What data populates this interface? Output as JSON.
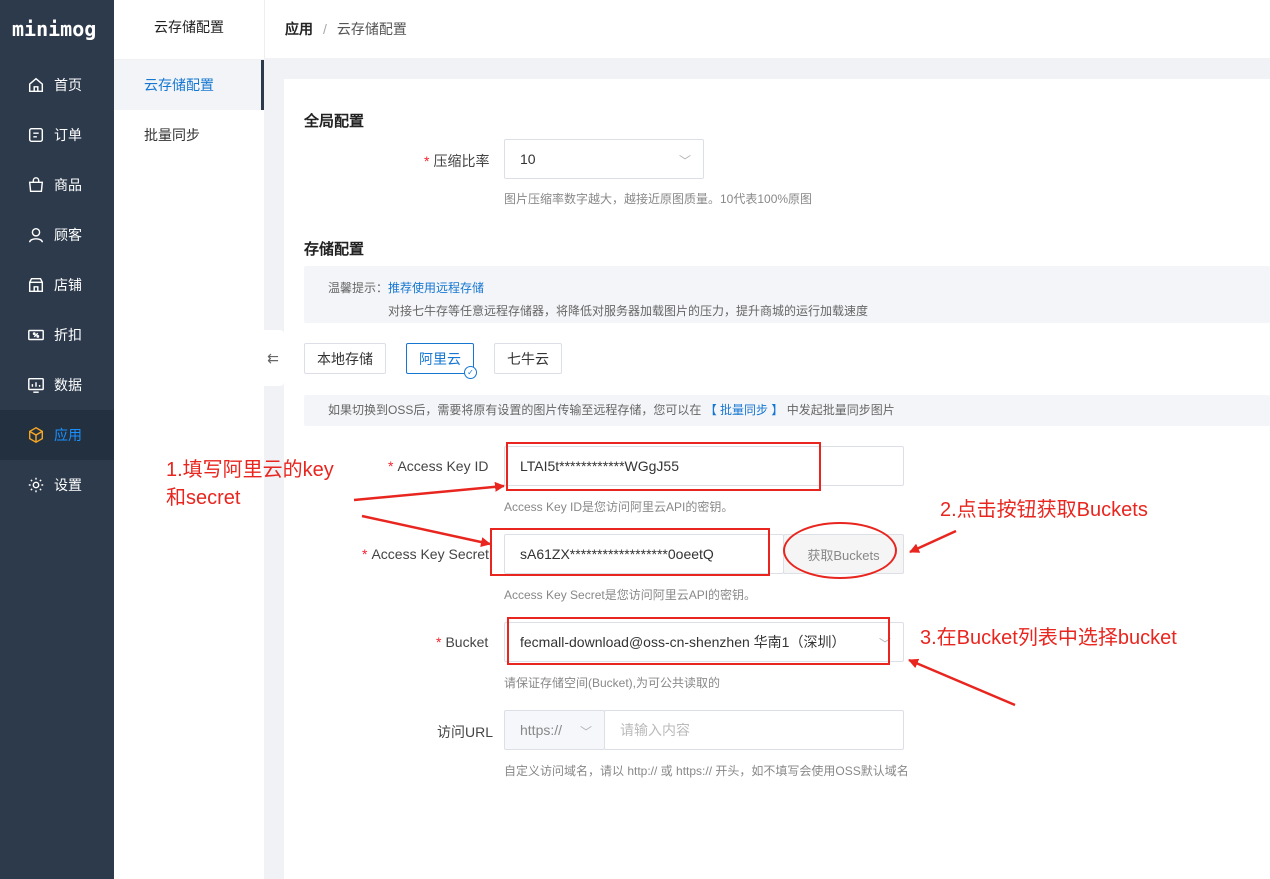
{
  "app": {
    "logo": "minimog"
  },
  "sidebar": {
    "items": [
      {
        "label": "首页",
        "icon": "home-icon",
        "active": false
      },
      {
        "label": "订单",
        "icon": "order-icon",
        "active": false
      },
      {
        "label": "商品",
        "icon": "bag-icon",
        "active": false
      },
      {
        "label": "顾客",
        "icon": "user-icon",
        "active": false
      },
      {
        "label": "店铺",
        "icon": "store-icon",
        "active": false
      },
      {
        "label": "折扣",
        "icon": "discount-icon",
        "active": false
      },
      {
        "label": "数据",
        "icon": "chart-icon",
        "active": false
      },
      {
        "label": "应用",
        "icon": "cube-icon",
        "active": true
      },
      {
        "label": "设置",
        "icon": "gear-icon",
        "active": false
      }
    ],
    "active_color": "#1890ff"
  },
  "subpanel": {
    "title": "云存储配置",
    "items": [
      {
        "label": "云存储配置",
        "active": true
      },
      {
        "label": "批量同步",
        "active": false
      }
    ]
  },
  "breadcrumb": {
    "root": "应用",
    "separator": "/",
    "current": "云存储配置"
  },
  "global_config": {
    "title": "全局配置",
    "compress_label": "压缩比率",
    "compress_value": "10",
    "compress_hint": "图片压缩率数字越大，越接近原图质量。10代表100%原图"
  },
  "storage_config": {
    "title": "存储配置",
    "tip_prefix": "温馨提示：",
    "tip_link": "推荐使用远程存储",
    "tip_body": "对接七牛存等任意远程存储器，将降低对服务器加载图片的压力，提升商城的运行加载速度",
    "tabs": [
      {
        "label": "本地存储",
        "active": false
      },
      {
        "label": "阿里云",
        "active": true
      },
      {
        "label": "七牛云",
        "active": false
      }
    ],
    "switch_tip_before": "如果切换到OSS后，需要将原有设置的图片传输至远程存储，您可以在",
    "switch_tip_link": "【 批量同步 】",
    "switch_tip_after": "中发起批量同步图片"
  },
  "form": {
    "access_key_id": {
      "label": "Access Key ID",
      "value": "LTAI5t************WGgJ55",
      "hint": "Access Key ID是您访问阿里云API的密钥。"
    },
    "access_key_secret": {
      "label": "Access Key Secret",
      "value": "sA61ZX******************0oeetQ",
      "hint": "Access Key Secret是您访问阿里云API的密钥。",
      "button": "获取Buckets"
    },
    "bucket": {
      "label": "Bucket",
      "value": "fecmall-download@oss-cn-shenzhen 华南1（深圳）",
      "hint": "请保证存储空间(Bucket),为可公共读取的"
    },
    "url": {
      "label": "访问URL",
      "protocol": "https://",
      "placeholder": "请输入内容",
      "hint": "自定义访问域名，请以 http:// 或 https:// 开头，如不填写会使用OSS默认域名"
    }
  },
  "annotations": {
    "step1_line1": "1.填写阿里云的key",
    "step1_line2": "和secret",
    "step2": "2.点击按钮获取Buckets",
    "step3": "3.在Bucket列表中选择bucket",
    "color": "#e8261f"
  }
}
